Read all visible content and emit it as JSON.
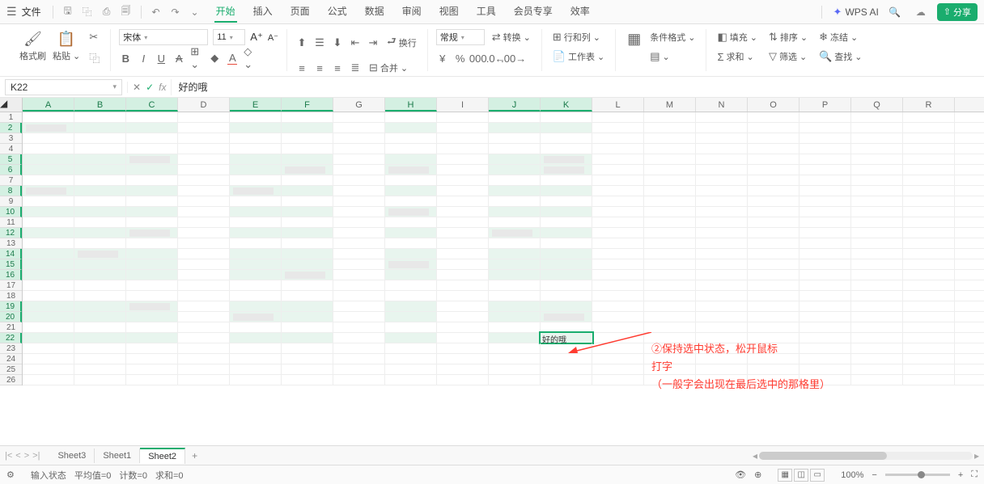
{
  "top": {
    "file": "文件",
    "tabs": [
      "开始",
      "插入",
      "页面",
      "公式",
      "数据",
      "审阅",
      "视图",
      "工具",
      "会员专享",
      "效率"
    ],
    "active_tab": 0,
    "ai": "WPS AI",
    "share": "分享"
  },
  "ribbon": {
    "format_painter": "格式刷",
    "paste": "粘贴",
    "font_name": "宋体",
    "font_size": "11",
    "wrap": "换行",
    "merge": "合并",
    "numfmt": "常规",
    "transpose": "转换",
    "rowcol": "行和列",
    "worksheet": "工作表",
    "cond_fmt": "条件格式",
    "fill": "填充",
    "sum": "求和",
    "sort": "排序",
    "filter": "筛选",
    "freeze": "冻结",
    "find": "查找"
  },
  "formula": {
    "cell_ref": "K22",
    "value": "好的哦"
  },
  "grid": {
    "cols": [
      "A",
      "B",
      "C",
      "D",
      "E",
      "F",
      "G",
      "H",
      "I",
      "J",
      "K",
      "L",
      "M",
      "N",
      "O",
      "P",
      "Q",
      "R"
    ],
    "rows": 26,
    "sel_cols": [
      "A",
      "B",
      "C",
      "E",
      "F",
      "H",
      "J",
      "K"
    ],
    "sel_rows": [
      2,
      5,
      6,
      8,
      10,
      12,
      14,
      15,
      16,
      19,
      20,
      22
    ],
    "cell_text": {
      "row": 22,
      "col": 10,
      "text": "好的哦"
    }
  },
  "annotation": {
    "line1": "②保持选中状态，松开鼠标",
    "line2": "打字",
    "line3": "（一般字会出现在最后选中的那格里）"
  },
  "sheets": {
    "tabs": [
      "Sheet3",
      "Sheet1",
      "Sheet2"
    ],
    "active": 2
  },
  "status": {
    "mode": "输入状态",
    "avg": "平均值=0",
    "count": "计数=0",
    "sum": "求和=0",
    "zoom": "100%"
  }
}
